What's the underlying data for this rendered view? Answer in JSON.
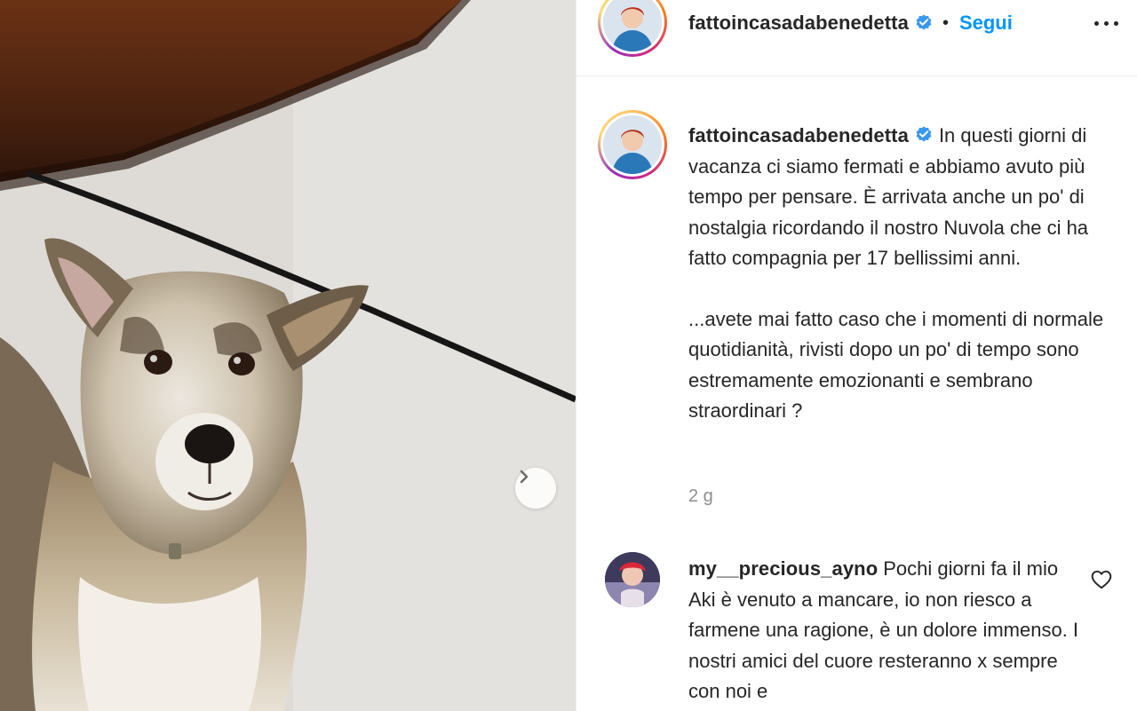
{
  "post": {
    "username": "fattoincasadabenedetta",
    "follow_label": "Segui",
    "separator": "•",
    "caption_paragraphs": [
      "In questi giorni di vacanza ci siamo fermati e abbiamo avuto più tempo per pensare. È arrivata anche un po' di nostalgia ricordando il nostro Nuvola che ci ha fatto compagnia per 17 bellissimi anni.",
      "...avete mai fatto caso che i momenti di normale quotidianità, rivisti dopo un po' di tempo sono estremamente emozionanti e sembrano straordinari ?"
    ],
    "time_ago": "2 g"
  },
  "comments": [
    {
      "username": "my__precious_ayno",
      "text": "Pochi giorni fa il mio Aki è venuto a mancare, io non riesco a farmene una ragione, è un dolore immenso. I nostri amici del cuore resteranno x sempre con noi e"
    }
  ],
  "icons": {
    "verified": "verified-badge-icon",
    "more": "more-options-icon",
    "next": "chevron-right-icon",
    "like": "heart-icon"
  },
  "colors": {
    "link_blue": "#0095f6",
    "text": "#262626",
    "secondary": "#8e8e8e",
    "verified": "#3897f0"
  }
}
